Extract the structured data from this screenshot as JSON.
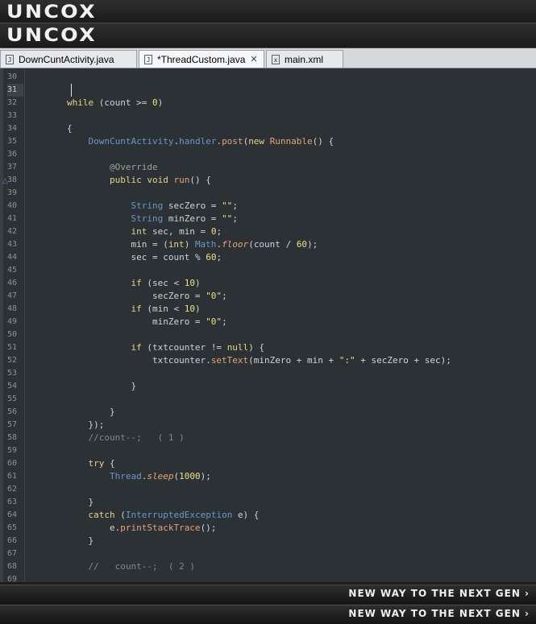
{
  "banners": {
    "logo_top": "UNCOX",
    "logo_bottom": "UNCOX"
  },
  "tabs": [
    {
      "label": "DownCuntActivity.java",
      "icon": "java-file-icon",
      "glyph": "J"
    },
    {
      "label": "*ThreadCustom.java",
      "icon": "java-file-icon",
      "glyph": "J",
      "close": "✕"
    },
    {
      "label": "main.xml",
      "icon": "xml-file-icon",
      "glyph": "x"
    }
  ],
  "code": {
    "current_line": 31,
    "lines": [
      {
        "n": "30",
        "html": ""
      },
      {
        "n": "31",
        "html": ""
      },
      {
        "n": "32",
        "html": "        <span class=\"kw\">while</span> <span class=\"p\">(</span><span class=\"v\">count</span> <span class=\"p\">&gt;=</span> <span class=\"n\">0</span><span class=\"p\">)</span>"
      },
      {
        "n": "33",
        "html": ""
      },
      {
        "n": "34",
        "html": "        <span class=\"p\">{</span>"
      },
      {
        "n": "35",
        "html": "            <span class=\"t\">DownCuntActivity</span><span class=\"p\">.</span><span class=\"t\">handler</span><span class=\"p\">.</span><span class=\"f\">post</span><span class=\"p\">(</span><span class=\"kw\">new</span> <span class=\"f\">Runnable</span><span class=\"p\">() {</span>"
      },
      {
        "n": "36",
        "html": ""
      },
      {
        "n": "37",
        "html": "                <span class=\"an\">@Override</span>"
      },
      {
        "n": "38",
        "html": "                <span class=\"kw\">public void</span> <span class=\"f\">run</span><span class=\"p\">() {</span>"
      },
      {
        "n": "39",
        "html": ""
      },
      {
        "n": "40",
        "html": "                    <span class=\"t\">String</span> <span class=\"p\">secZero =</span> <span class=\"s\">\"\"</span><span class=\"p\">;</span>"
      },
      {
        "n": "41",
        "html": "                    <span class=\"t\">String</span> <span class=\"p\">minZero =</span> <span class=\"s\">\"\"</span><span class=\"p\">;</span>"
      },
      {
        "n": "42",
        "html": "                    <span class=\"kw\">int</span> <span class=\"p\">sec, min =</span> <span class=\"n\">0</span><span class=\"p\">;</span>"
      },
      {
        "n": "43",
        "html": "                    <span class=\"p\">min = (</span><span class=\"kw\">int</span><span class=\"p\">)</span> <span class=\"t\">Math</span><span class=\"p\">.</span><span class=\"fi\">floor</span><span class=\"p\">(</span><span class=\"v\">count</span> <span class=\"p\">/</span> <span class=\"n\">60</span><span class=\"p\">);</span>"
      },
      {
        "n": "44",
        "html": "                    <span class=\"p\">sec =</span> <span class=\"v\">count</span> <span class=\"p\">%</span> <span class=\"n\">60</span><span class=\"p\">;</span>"
      },
      {
        "n": "45",
        "html": ""
      },
      {
        "n": "46",
        "html": "                    <span class=\"kw\">if</span> <span class=\"p\">(sec &lt;</span> <span class=\"n\">10</span><span class=\"p\">)</span>"
      },
      {
        "n": "47",
        "html": "                        <span class=\"p\">secZero =</span> <span class=\"s\">\"0\"</span><span class=\"p\">;</span>"
      },
      {
        "n": "48",
        "html": "                    <span class=\"kw\">if</span> <span class=\"p\">(min &lt;</span> <span class=\"n\">10</span><span class=\"p\">)</span>"
      },
      {
        "n": "49",
        "html": "                        <span class=\"p\">minZero =</span> <span class=\"s\">\"0\"</span><span class=\"p\">;</span>"
      },
      {
        "n": "50",
        "html": ""
      },
      {
        "n": "51",
        "html": "                    <span class=\"kw\">if</span> <span class=\"p\">(</span><span class=\"v\">txtcounter</span> <span class=\"p\">!=</span> <span class=\"kw\">null</span><span class=\"p\">) {</span>"
      },
      {
        "n": "52",
        "html": "                        <span class=\"v\">txtcounter</span><span class=\"p\">.</span><span class=\"f\">setText</span><span class=\"p\">(minZero + min +</span> <span class=\"s\">\":\"</span> <span class=\"p\">+ secZero + sec);</span>"
      },
      {
        "n": "53",
        "html": ""
      },
      {
        "n": "54",
        "html": "                    <span class=\"p\">}</span>"
      },
      {
        "n": "55",
        "html": ""
      },
      {
        "n": "56",
        "html": "                <span class=\"p\">}</span>"
      },
      {
        "n": "57",
        "html": "            <span class=\"p\">});</span>"
      },
      {
        "n": "58",
        "html": "            <span class=\"c\">//count--;   ( 1 )</span>"
      },
      {
        "n": "59",
        "html": ""
      },
      {
        "n": "60",
        "html": "            <span class=\"kw\">try</span> <span class=\"p\">{</span>"
      },
      {
        "n": "61",
        "html": "                <span class=\"t\">Thread</span><span class=\"p\">.</span><span class=\"fi\">sleep</span><span class=\"p\">(</span><span class=\"n\">1000</span><span class=\"p\">);</span>"
      },
      {
        "n": "62",
        "html": ""
      },
      {
        "n": "63",
        "html": "            <span class=\"p\">}</span>"
      },
      {
        "n": "64",
        "html": "            <span class=\"kw\">catch</span> <span class=\"p\">(</span><span class=\"t\">InterruptedException</span> <span class=\"p\">e) {</span>"
      },
      {
        "n": "65",
        "html": "                <span class=\"p\">e.</span><span class=\"f\">printStackTrace</span><span class=\"p\">();</span>"
      },
      {
        "n": "66",
        "html": "            <span class=\"p\">}</span>"
      },
      {
        "n": "67",
        "html": ""
      },
      {
        "n": "68",
        "html": "            <span class=\"c\">//   count--;  ( 2 )</span>"
      },
      {
        "n": "69",
        "html": ""
      }
    ]
  },
  "footers": {
    "tagline_top": "NEW WAY TO THE NEXT GEN ›",
    "tagline_bottom": "NEW WAY TO THE NEXT GEN ›"
  }
}
